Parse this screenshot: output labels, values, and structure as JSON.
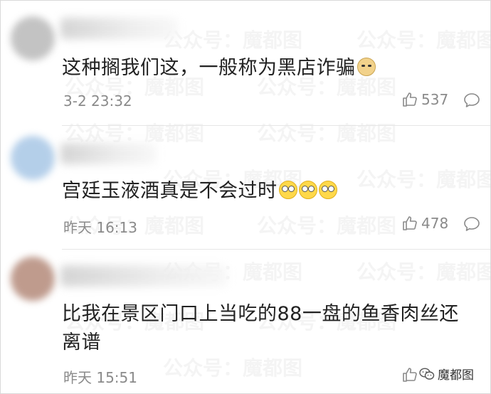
{
  "comments": [
    {
      "text": "这种搁我们这，一般称为黑店诈骗",
      "emojis": [
        "dog"
      ],
      "time": "3-2 23:32",
      "likes": "537",
      "avatar_color": "#b9b9b9"
    },
    {
      "text": "宫廷玉液酒真是不会过时",
      "emojis": [
        "flushed",
        "flushed",
        "flushed"
      ],
      "time": "昨天 16:13",
      "likes": "478",
      "avatar_color": "#a8c7e6"
    },
    {
      "text_line1": "比我在景区门口上当吃的88一盘的鱼香肉丝还",
      "text_line2": "离谱",
      "time": "昨天 15:51",
      "avatar_color": "#b48a7a"
    }
  ],
  "watermark": {
    "text": "公众号：魔都图"
  },
  "brand": {
    "label": "魔都图"
  },
  "icons": {
    "like": "thumbs-up-icon",
    "reply": "comment-bubble-icon",
    "brand": "wechat-logo-icon"
  }
}
